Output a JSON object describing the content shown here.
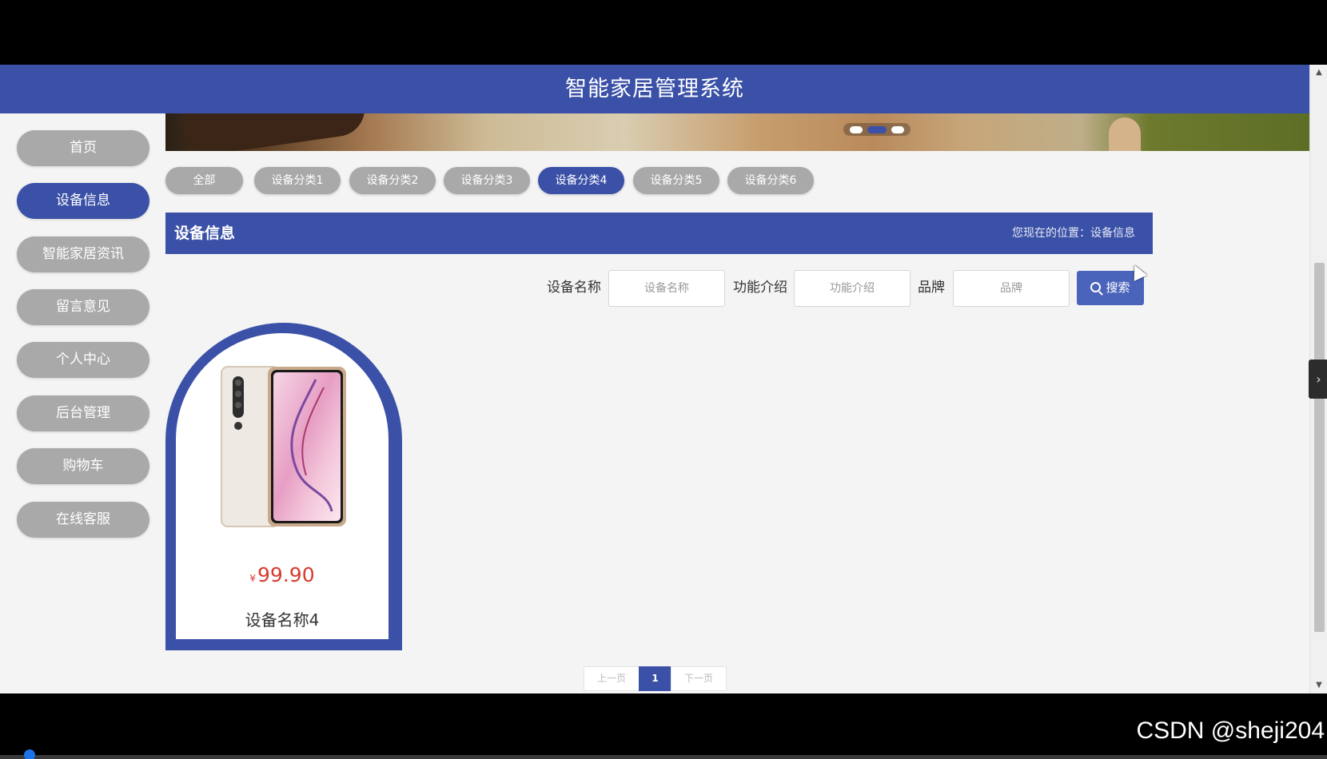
{
  "header": {
    "title": "智能家居管理系统"
  },
  "sidebar": {
    "items": [
      {
        "label": "首页",
        "active": false
      },
      {
        "label": "设备信息",
        "active": true
      },
      {
        "label": "智能家居资讯",
        "active": false
      },
      {
        "label": "留言意见",
        "active": false
      },
      {
        "label": "个人中心",
        "active": false
      },
      {
        "label": "后台管理",
        "active": false
      },
      {
        "label": "购物车",
        "active": false
      },
      {
        "label": "在线客服",
        "active": false
      }
    ]
  },
  "categories": [
    {
      "label": "全部",
      "active": false
    },
    {
      "label": "设备分类1",
      "active": false
    },
    {
      "label": "设备分类2",
      "active": false
    },
    {
      "label": "设备分类3",
      "active": false
    },
    {
      "label": "设备分类4",
      "active": true
    },
    {
      "label": "设备分类5",
      "active": false
    },
    {
      "label": "设备分类6",
      "active": false
    }
  ],
  "section": {
    "title": "设备信息",
    "location": "您现在的位置：设备信息"
  },
  "search": {
    "fields": [
      {
        "label": "设备名称",
        "placeholder": "设备名称"
      },
      {
        "label": "功能介绍",
        "placeholder": "功能介绍"
      },
      {
        "label": "品牌",
        "placeholder": "品牌"
      }
    ],
    "button_label": "搜索"
  },
  "products": [
    {
      "currency": "¥",
      "price": "99.90",
      "name": "设备名称4"
    }
  ],
  "pagination": {
    "prev_label": "上一页",
    "current": "1",
    "next_label": "下一页"
  },
  "carousel": {
    "slides": 3,
    "active_index": 1
  },
  "watermark": "CSDN @sheji204",
  "colors": {
    "primary": "#3b51a7",
    "inactive": "#a9a9a9",
    "price": "#d63b2f"
  }
}
